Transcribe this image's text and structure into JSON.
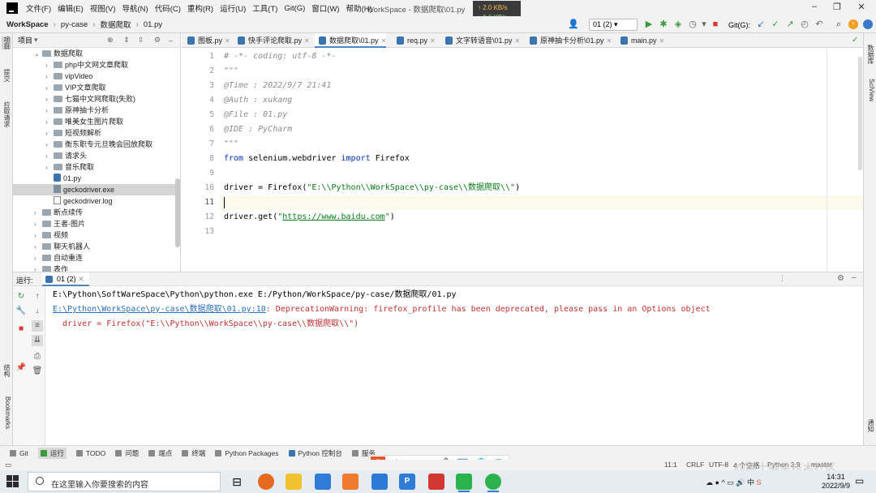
{
  "menu": {
    "items": [
      "文件(F)",
      "编辑(E)",
      "视图(V)",
      "导航(N)",
      "代码(C)",
      "重构(R)",
      "运行(U)",
      "工具(T)",
      "Git(G)",
      "窗口(W)",
      "帮助(H)"
    ],
    "window_title": "WorkSpace - 数据爬取\\01.py"
  },
  "network": {
    "up": "↑ 2.0 KB/s",
    "down": "↓ 0.6 KB/s"
  },
  "navbar": {
    "crumbs": [
      "WorkSpace",
      "py-case",
      "数据爬取",
      "01.py"
    ],
    "run_config": "01 (2)",
    "git_label": "Git(G):"
  },
  "project": {
    "header": "项目",
    "tree": [
      {
        "label": "数据爬取",
        "type": "folder",
        "open": true,
        "level": 1
      },
      {
        "label": "php中文网文章爬取",
        "type": "folder",
        "level": 2
      },
      {
        "label": "vipVideo",
        "type": "folder",
        "level": 2
      },
      {
        "label": "VIP文章爬取",
        "type": "folder",
        "level": 2
      },
      {
        "label": "七猫中文网爬取(失败)",
        "type": "folder",
        "level": 2
      },
      {
        "label": "原神抽卡分析",
        "type": "folder",
        "level": 2
      },
      {
        "label": "唯美女生图片爬取",
        "type": "folder",
        "level": 2
      },
      {
        "label": "短视频解析",
        "type": "folder",
        "level": 2
      },
      {
        "label": "衡东职专元旦晚会回放爬取",
        "type": "folder",
        "level": 2
      },
      {
        "label": "请求头",
        "type": "folder",
        "level": 2
      },
      {
        "label": "音乐爬取",
        "type": "folder",
        "level": 2
      },
      {
        "label": "01.py",
        "type": "py",
        "level": 2
      },
      {
        "label": "geckodriver.exe",
        "type": "exe",
        "level": 2,
        "selected": true
      },
      {
        "label": "geckodriver.log",
        "type": "log",
        "level": 2
      },
      {
        "label": "断点续传",
        "type": "folder",
        "level": 1
      },
      {
        "label": "王者-图片",
        "type": "folder",
        "level": 1
      },
      {
        "label": "视频",
        "type": "folder",
        "level": 1
      },
      {
        "label": "聊天机器人",
        "type": "folder",
        "level": 1
      },
      {
        "label": "自动重连",
        "type": "folder",
        "level": 1
      },
      {
        "label": "表作",
        "type": "folder",
        "level": 1
      }
    ]
  },
  "tabs": [
    "图板.py",
    "快手评论爬取.py",
    "数据爬取\\01.py",
    "req.py",
    "文字转语音\\01.py",
    "原神抽卡分析\\01.py",
    "main.py"
  ],
  "active_tab_index": 2,
  "editor": {
    "line_numbers": [
      "1",
      "2",
      "3",
      "4",
      "5",
      "6",
      "7",
      "8",
      "9",
      "10",
      "11",
      "12",
      "13"
    ],
    "lines": [
      {
        "t": "cmt",
        "text": "# -*- coding: utf-8 -*-"
      },
      {
        "t": "cmt",
        "text": "\"\"\""
      },
      {
        "t": "cmt",
        "text": "@Time : 2022/9/7 21:41"
      },
      {
        "t": "cmt",
        "text": "@Auth : xukang"
      },
      {
        "t": "cmt",
        "text": "@File : 01.py"
      },
      {
        "t": "cmt",
        "text": "@IDE : PyCharm"
      },
      {
        "t": "cmt",
        "text": "\"\"\""
      },
      {
        "t": "import",
        "kw1": "from",
        "mod": " selenium.webdriver ",
        "kw2": "import",
        "name": " Firefox"
      },
      {
        "t": "blank",
        "text": ""
      },
      {
        "t": "call",
        "pre": "driver = Firefox(",
        "str": "\"E:\\\\Python\\\\WorkSpace\\\\py-case\\\\数据爬取\\\\\"",
        "post": ")"
      },
      {
        "t": "caret",
        "text": ""
      },
      {
        "t": "get",
        "pre": "driver.get(",
        "q1": "\"",
        "url": "https://www.baidu.com",
        "q2": "\"",
        "post": ")"
      },
      {
        "t": "blank",
        "text": ""
      }
    ]
  },
  "run": {
    "label": "运行:",
    "tab": "01 (2)",
    "console": [
      {
        "style": "plain",
        "text": "E:\\Python\\SoftWareSpace\\Python\\python.exe E:/Python/WorkSpace/py-case/数据爬取/01.py"
      },
      {
        "style": "mixed",
        "link": "E:\\Python\\WorkSpace\\py-case\\数据爬取\\01.py:10",
        "err": ": DeprecationWarning: firefox_profile has been deprecated, please pass in an Options object"
      },
      {
        "style": "err",
        "text": "  driver = Firefox(\"E:\\\\Python\\\\WorkSpace\\\\py-case\\\\数据爬取\\\\\")"
      }
    ]
  },
  "bottom_tools": [
    "Git",
    "运行",
    "TODO",
    "问题",
    "端点",
    "终端",
    "Python Packages",
    "Python 控制台",
    "服务"
  ],
  "left_stripe": [
    "项目",
    "提交",
    "拉取请求",
    "结构",
    "Bookmarks"
  ],
  "right_stripe": [
    "数据库",
    "SciView",
    "通知"
  ],
  "status": {
    "position": "11:1",
    "line_sep": "CRLF",
    "encoding": "UTF-8",
    "indent": "4 个空格",
    "interpreter": "Python 3.9",
    "branch": "master"
  },
  "taskbar": {
    "search_placeholder": "在这里输入你要搜索的内容",
    "time": "14:31",
    "date": "2022/9/9",
    "tray_text": "中"
  },
  "watermark": "@稀土掘金技术社区",
  "colors": {
    "accent": "#4a88c7",
    "keyword": "#0033b3",
    "string": "#067d17",
    "comment": "#8c8c8c",
    "error": "#c03030"
  }
}
